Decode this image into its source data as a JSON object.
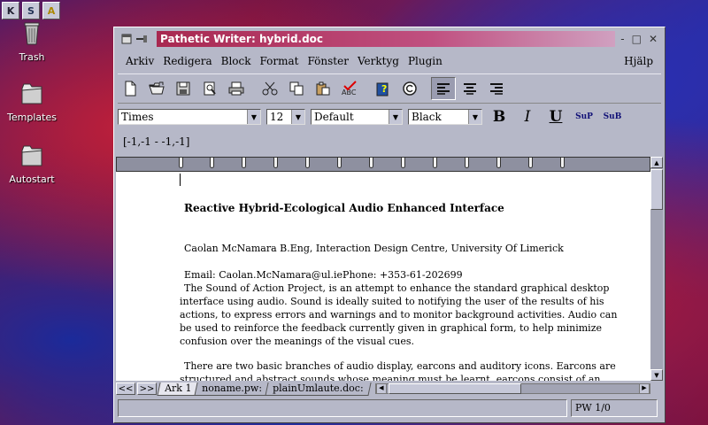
{
  "panel": {
    "buttons": [
      "K",
      "S",
      "A"
    ]
  },
  "desktop": {
    "icons": [
      {
        "label": "Trash"
      },
      {
        "label": "Templates"
      },
      {
        "label": "Autostart"
      }
    ]
  },
  "window": {
    "title": "Pathetic Writer: hybrid.doc",
    "controls": [
      "-",
      "□",
      "✕"
    ]
  },
  "menu": {
    "items": [
      "Arkiv",
      "Redigera",
      "Block",
      "Format",
      "Fönster",
      "Verktyg",
      "Plugin"
    ],
    "help": "Hjälp"
  },
  "format": {
    "font": "Times",
    "size": "12",
    "style": "Default",
    "color": "Black",
    "bold": "B",
    "italic": "I",
    "underline": "U",
    "sup": "SuP",
    "sub": "SuB"
  },
  "coordinates": "[-1,-1 - -1,-1]",
  "document": {
    "title": "Reactive Hybrid-Ecological Audio Enhanced Interface",
    "author": "Caolan McNamara B.Eng, Interaction Design Centre, University Of Limerick",
    "email": "Email: Caolan.McNamara@ul.iePhone: +353-61-202699",
    "para1": "The Sound of Action Project, is an attempt to enhance the standard graphical desktop\ninterface using audio. Sound is ideally suited to notifying the user of the results of his\nactions, to express errors and warnings and to monitor background activities. Audio can\nbe used to reinforce the feedback currently given in graphical form, to help minimize\nconfusion over the meanings of the visual cues.",
    "para2": "There are two basic branches of audio display, earcons and auditory icons. Earcons are\nstructured and abstract sounds whose meaning must be learnt, earcons consist of an"
  },
  "sheets": {
    "nav_prev": "<<",
    "nav_next": ">>",
    "tabs": [
      "Ark 1",
      "noname.pw:",
      "plainUmlaute.doc:"
    ]
  },
  "status": {
    "page": "PW 1/0"
  }
}
